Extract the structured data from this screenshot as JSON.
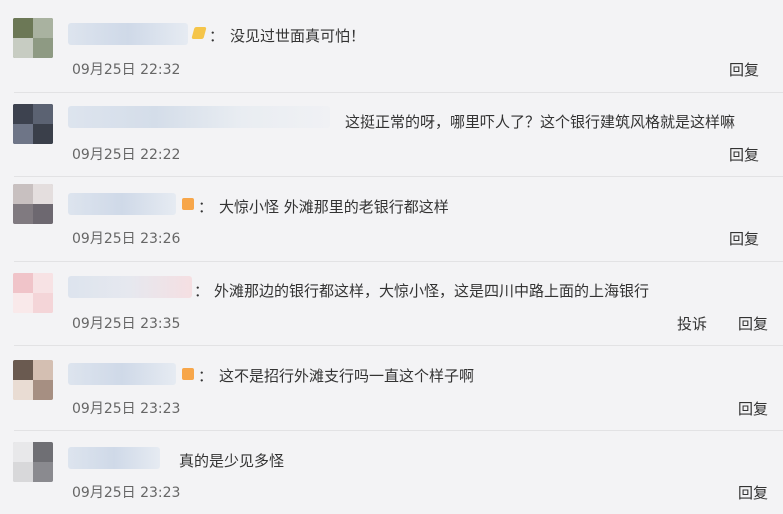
{
  "comments": [
    {
      "text": "没见过世面真可怕！",
      "colon": "：",
      "time": "09月25日 22:32",
      "actions": [
        "回复"
      ]
    },
    {
      "text": "这挺正常的呀，哪里吓人了？这个银行建筑风格就是这样嘛",
      "colon": "",
      "time": "09月25日 22:22",
      "actions": [
        "回复"
      ]
    },
    {
      "text": "大惊小怪 外滩那里的老银行都这样",
      "colon": "：",
      "time": "09月25日 23:26",
      "actions": [
        "回复"
      ]
    },
    {
      "text": "外滩那边的银行都这样，大惊小怪，这是四川中路上面的上海银行",
      "colon": "：",
      "time": "09月25日 23:35",
      "actions": [
        "投诉",
        "回复"
      ]
    },
    {
      "text": "这不是招行外滩支行吗一直这个样子啊",
      "colon": "：",
      "time": "09月25日 23:23",
      "actions": [
        "回复"
      ]
    },
    {
      "text": "真的是少见多怪",
      "colon": "",
      "time": "09月25日 23:23",
      "actions": [
        "回复"
      ]
    }
  ],
  "colors": {
    "background": "#f3f3f5",
    "badge_yellow": "#f5c54a",
    "badge_orange": "#f7a64a"
  }
}
